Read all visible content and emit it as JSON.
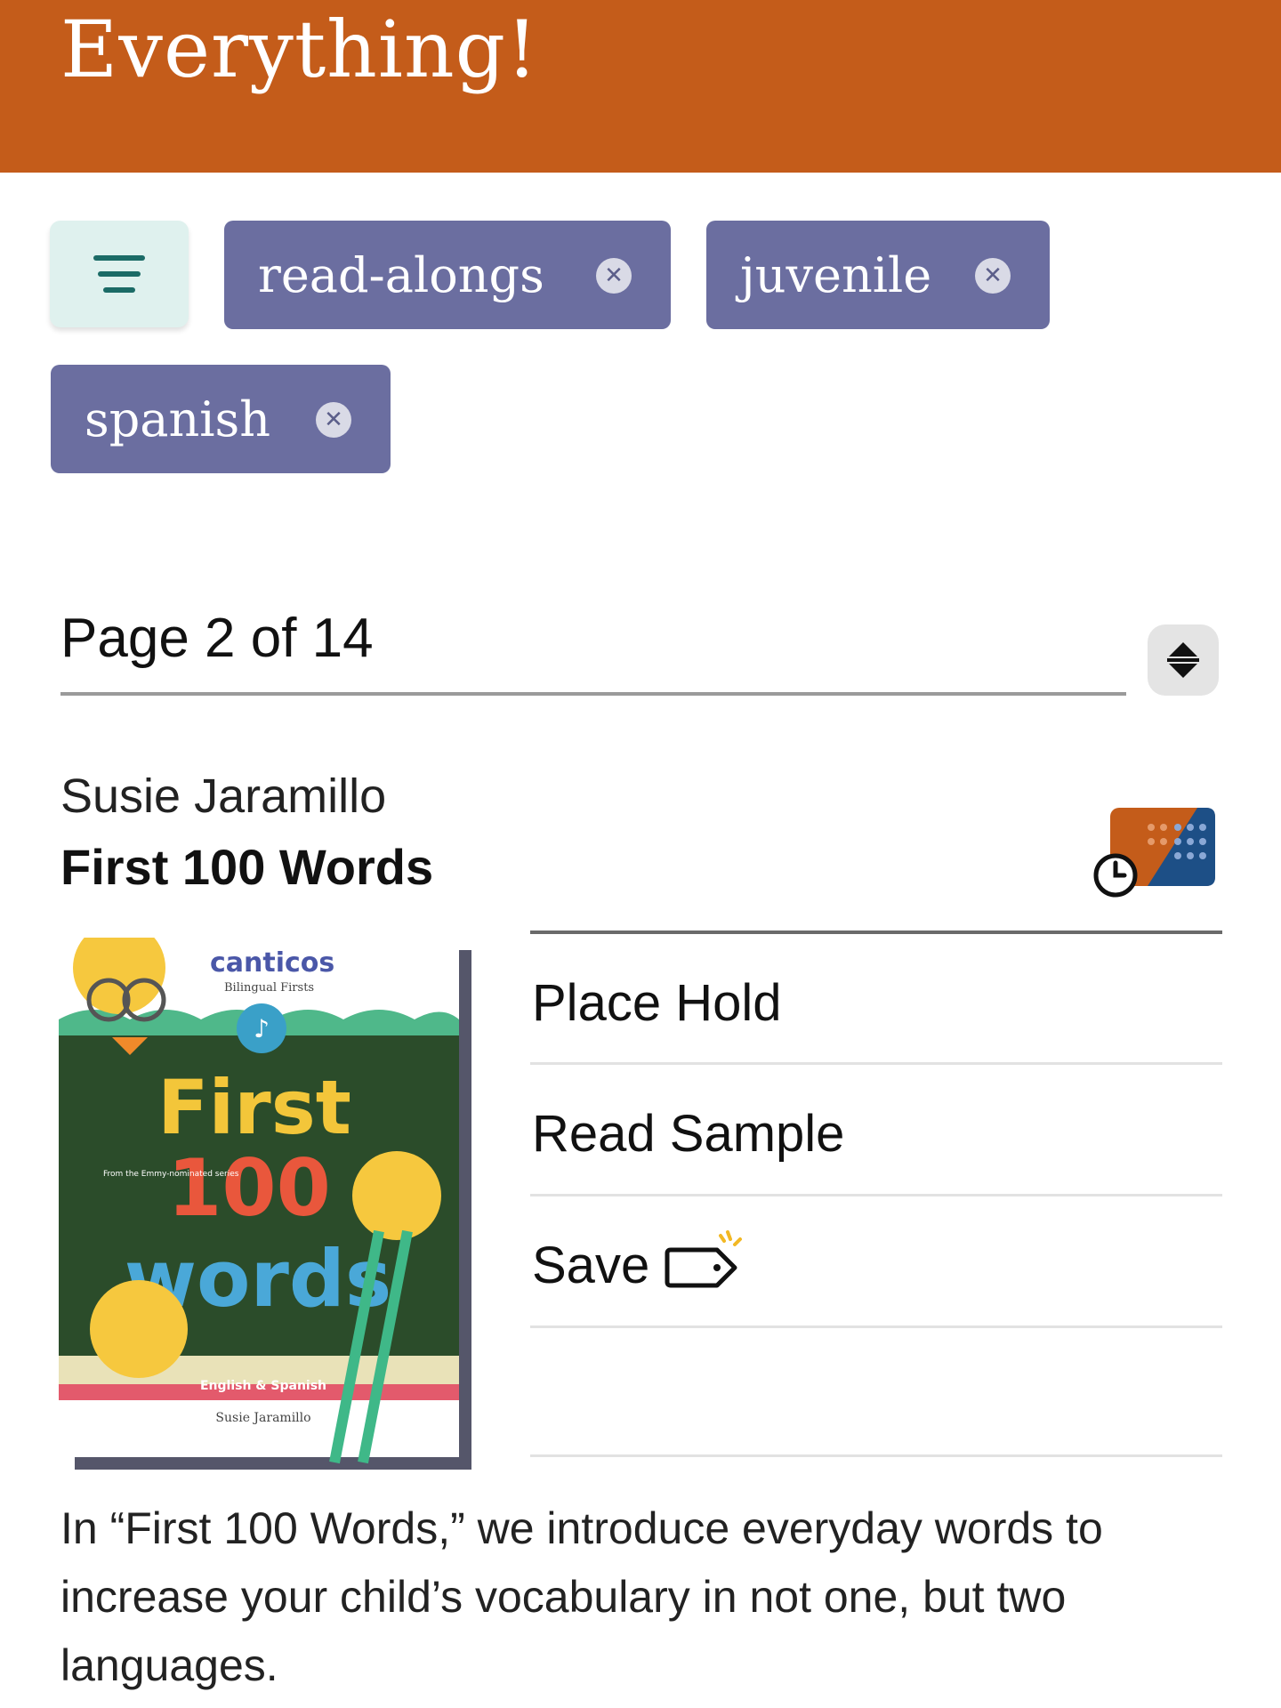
{
  "header": {
    "title": "Everything!",
    "color": "#c45c1a"
  },
  "filters": {
    "menu_icon": "filter-lines-icon",
    "chips": [
      {
        "label": "read-alongs",
        "remove_icon": "close-icon"
      },
      {
        "label": "juvenile",
        "remove_icon": "close-icon"
      },
      {
        "label": "spanish",
        "remove_icon": "close-icon"
      }
    ],
    "chip_color": "#6b6ea0"
  },
  "pagination": {
    "label": "Page 2 of 14",
    "stepper_icon": "up-down-arrows-icon"
  },
  "book": {
    "author": "Susie Jaramillo",
    "title": "First 100 Words",
    "format_icon": "ebook-availability-icon",
    "cover": {
      "brand": "canticos",
      "series": "Bilingual Firsts",
      "title_lines": [
        "First",
        "100",
        "words"
      ],
      "badge": "From the Emmy-nominated series",
      "languages": "English & Spanish",
      "author": "Susie Jaramillo"
    },
    "actions": [
      {
        "label": "Place Hold"
      },
      {
        "label": "Read Sample"
      },
      {
        "label": "Save",
        "icon": "tag-icon"
      }
    ],
    "description": "In “First 100 Words,” we introduce everyday words to increase your child’s vocabulary in not one, but two languages."
  }
}
